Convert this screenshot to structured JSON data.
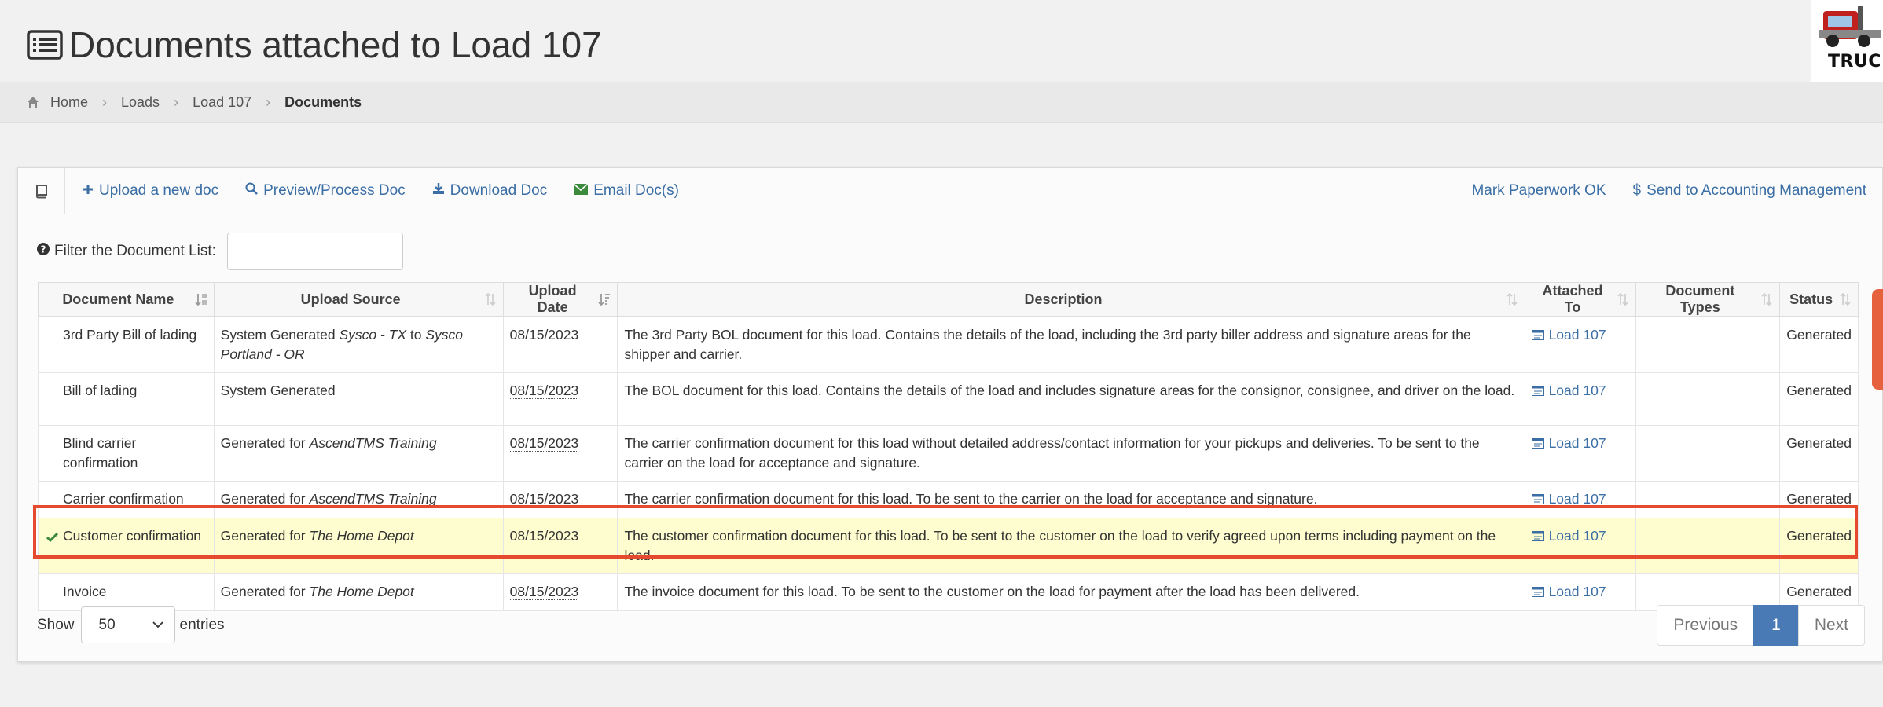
{
  "page": {
    "title": "Documents attached to Load 107",
    "logo_text": "TRUCK"
  },
  "breadcrumb": {
    "items": [
      "Home",
      "Loads",
      "Load 107",
      "Documents"
    ]
  },
  "toolbar": {
    "upload": "Upload a new doc",
    "preview": "Preview/Process Doc",
    "download": "Download Doc",
    "email": "Email Doc(s)",
    "mark_ok": "Mark Paperwork OK",
    "send_accounting": "Send to Accounting Management"
  },
  "filter": {
    "label": "Filter the Document List:",
    "value": ""
  },
  "table": {
    "columns": [
      "Document Name",
      "Upload Source",
      "Upload Date",
      "Description",
      "Attached To",
      "Document Types",
      "Status"
    ],
    "rows": [
      {
        "name": "3rd Party Bill of lading",
        "source_prefix": "System Generated",
        "source_italic": "Sysco - TX",
        "source_mid": "to",
        "source_italic2": "Sysco Portland - OR",
        "date": "08/15/2023",
        "description": "The 3rd Party BOL document for this load. Contains the details of the load, including the 3rd party biller address and signature areas for the shipper and carrier.",
        "attached": "Load 107",
        "types": "",
        "status": "Generated"
      },
      {
        "name": "Bill of lading",
        "source_prefix": "System Generated",
        "date": "08/15/2023",
        "description": "The BOL document for this load. Contains the details of the load and includes signature areas for the consignor, consignee, and driver on the load.",
        "attached": "Load 107",
        "types": "",
        "status": "Generated"
      },
      {
        "name": "Blind carrier confirmation",
        "source_prefix": "Generated for",
        "source_italic": "AscendTMS Training",
        "date": "08/15/2023",
        "description": "The carrier confirmation document for this load without detailed address/contact information for your pickups and deliveries. To be sent to the carrier on the load for acceptance and signature.",
        "attached": "Load 107",
        "types": "",
        "status": "Generated"
      },
      {
        "name": "Carrier confirmation",
        "source_prefix": "Generated for",
        "source_italic": "AscendTMS Training",
        "date": "08/15/2023",
        "description": "The carrier confirmation document for this load. To be sent to the carrier on the load for acceptance and signature.",
        "attached": "Load 107",
        "types": "",
        "status": "Generated"
      },
      {
        "name": "Customer confirmation",
        "source_prefix": "Generated for",
        "source_italic": "The Home Depot",
        "date": "08/15/2023",
        "description": "The customer confirmation document for this load. To be sent to the customer on the load to verify agreed upon terms including payment on the load.",
        "attached": "Load 107",
        "types": "",
        "status": "Generated"
      },
      {
        "name": "Invoice",
        "source_prefix": "Generated for",
        "source_italic": "The Home Depot",
        "date": "08/15/2023",
        "description": "The invoice document for this load. To be sent to the customer on the load for payment after the load has been delivered.",
        "attached": "Load 107",
        "types": "",
        "status": "Generated"
      }
    ]
  },
  "footer": {
    "show_label": "Show",
    "entries_value": "50",
    "entries_label": "entries",
    "prev": "Previous",
    "page": "1",
    "next": "Next"
  },
  "colors": {
    "link": "#3a6ea5",
    "highlight_row": "#fdfdcf",
    "highlight_border": "#e64a2e",
    "page_active": "#4a7ab5",
    "check": "#3c8a3c"
  }
}
